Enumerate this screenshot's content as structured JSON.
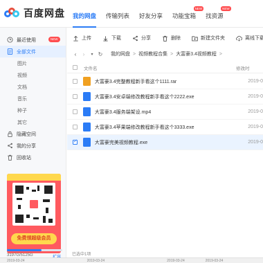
{
  "app": {
    "logo_text": "百度网盘"
  },
  "nav": [
    {
      "label": "我的网盘",
      "active": true,
      "badge": ""
    },
    {
      "label": "传输列表",
      "active": false,
      "badge": ""
    },
    {
      "label": "好友分享",
      "active": false,
      "badge": ""
    },
    {
      "label": "功能宝箱",
      "active": false,
      "badge": "NEW"
    },
    {
      "label": "找资源",
      "active": false,
      "badge": "NEW"
    }
  ],
  "sidebar": {
    "items": [
      {
        "label": "最近使用",
        "icon": "clock-icon",
        "badge": "NEW"
      },
      {
        "label": "全部文件",
        "icon": "document-icon",
        "active": true
      },
      {
        "label": "图片",
        "sub": true
      },
      {
        "label": "视频",
        "sub": true
      },
      {
        "label": "文档",
        "sub": true
      },
      {
        "label": "音乐",
        "sub": true
      },
      {
        "label": "种子",
        "sub": true
      },
      {
        "label": "其它",
        "sub": true
      },
      {
        "label": "隐藏空间",
        "icon": "lock-icon"
      },
      {
        "label": "我的分享",
        "icon": "share-icon"
      },
      {
        "label": "回收站",
        "icon": "trash-icon"
      }
    ],
    "promo_button": "免费领超级会员",
    "storage_text": "3197G/5125G",
    "storage_used_fraction": 0.62,
    "expand_label": "扩容"
  },
  "toolbar": {
    "upload": "上传",
    "download": "下载",
    "share": "分享",
    "delete": "删除",
    "new_folder": "新建文件夹",
    "offline_download": "离线下载"
  },
  "breadcrumb": [
    "我的网盘",
    "视频教程合集",
    "大富豪3.4视频教程"
  ],
  "table": {
    "col_name": "文件名",
    "col_modified": "修改时",
    "rows": [
      {
        "name": "大富豪3.4完整教程新手看这个1111.rar",
        "date": "2019-0",
        "type": "rar",
        "selected": false
      },
      {
        "name": "大富豪3.4安卓端修改教程新手看这个2222.exe",
        "date": "2019-0",
        "type": "exe",
        "selected": false
      },
      {
        "name": "大富豪3.4服务端架设.mp4",
        "date": "2019-0",
        "type": "video",
        "selected": false
      },
      {
        "name": "大富豪3.4苹果端修改教程新手看这个3333.exe",
        "date": "2019-0",
        "type": "exe",
        "selected": false
      },
      {
        "name": "大富豪完美视频教程.exe",
        "date": "2019-0",
        "type": "exe",
        "selected": true
      }
    ]
  },
  "status": {
    "selected_count": "已选中1项"
  },
  "peek": {
    "dates": [
      "2019-03-24",
      "2019-03-24",
      "2019-03-24",
      "2019-03-24"
    ]
  },
  "colors": {
    "accent": "#2b7cf6",
    "badge": "#ff4d4f",
    "promo": "#ff5a5f",
    "promo_yellow": "#ffd84d"
  }
}
